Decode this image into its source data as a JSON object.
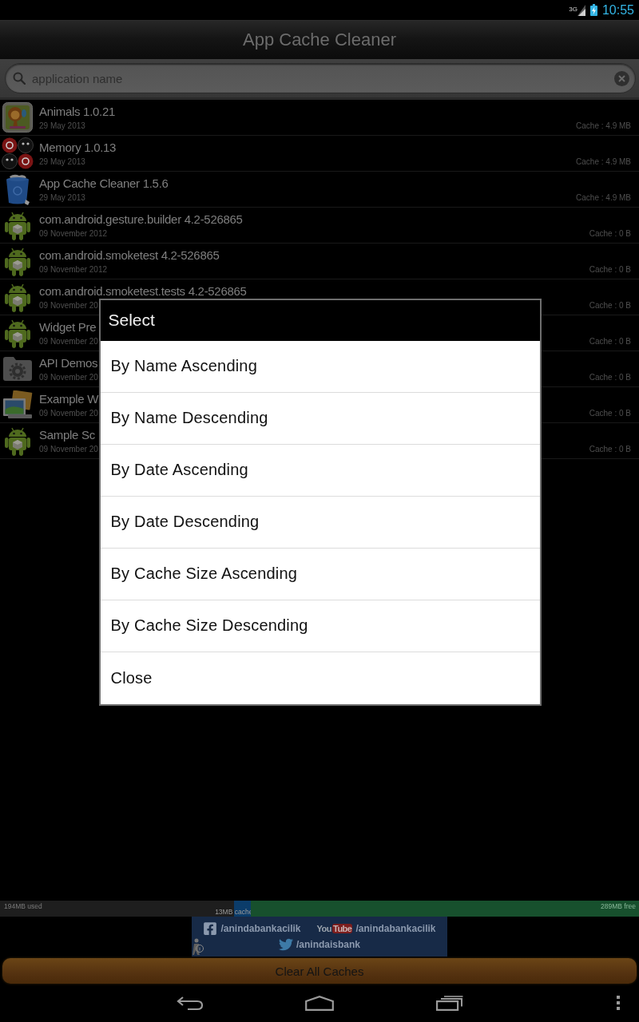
{
  "status_bar": {
    "network": "3G",
    "time": "10:55"
  },
  "title_bar": {
    "title": "App Cache Cleaner"
  },
  "search": {
    "placeholder": "application name"
  },
  "apps": [
    {
      "kind": "lion",
      "name": "Animals 1.0.21",
      "date": "29 May 2013",
      "cache": "Cache : 4.9 MB"
    },
    {
      "kind": "faces",
      "name": "Memory 1.0.13",
      "date": "29 May 2013",
      "cache": "Cache : 4.9 MB"
    },
    {
      "kind": "trash",
      "name": "App Cache Cleaner 1.5.6",
      "date": "29 May 2013",
      "cache": "Cache : 4.9 MB"
    },
    {
      "kind": "robot",
      "name": "com.android.gesture.builder 4.2-526865",
      "date": "09 November 2012",
      "cache": "Cache : 0 B"
    },
    {
      "kind": "robot",
      "name": "com.android.smoketest 4.2-526865",
      "date": "09 November 2012",
      "cache": "Cache : 0 B"
    },
    {
      "kind": "robot",
      "name": "com.android.smoketest.tests 4.2-526865",
      "date": "09 November 20",
      "cache": "Cache : 0 B"
    },
    {
      "kind": "robot",
      "name": "Widget Pre",
      "date": "09 November 20",
      "cache": "Cache : 0 B"
    },
    {
      "kind": "gear-folder",
      "name": "API Demos",
      "date": "09 November 20",
      "cache": "Cache : 0 B"
    },
    {
      "kind": "pictures",
      "name": "Example W",
      "date": "09 November 20",
      "cache": "Cache : 0 B"
    },
    {
      "kind": "robot",
      "name": "Sample Sc",
      "date": "09 November 20",
      "cache": "Cache : 0 B"
    }
  ],
  "storage": {
    "segments": [
      {
        "kind": "used",
        "label": "194MB used",
        "level": 0.366
      },
      {
        "kind": "cache",
        "label": "13MB cache",
        "level": 0.027
      },
      {
        "kind": "free",
        "label": "289MB free",
        "level": 0.607
      }
    ]
  },
  "banner": {
    "links": [
      {
        "kind": "facebook",
        "handle": "/anindabankacilik"
      },
      {
        "kind": "youtube",
        "logo": [
          "You",
          "Tube"
        ],
        "handle": "/anindabankacilik"
      },
      {
        "kind": "twitter",
        "handle": "/anindaisbank"
      }
    ]
  },
  "clear_button": {
    "label": "Clear All Caches"
  },
  "dialog": {
    "title": "Select",
    "options": [
      "By Name Ascending",
      "By Name Descending",
      "By Date Ascending",
      "By Date Descending",
      "By Cache Size Ascending",
      "By Cache Size Descending",
      "Close"
    ]
  }
}
